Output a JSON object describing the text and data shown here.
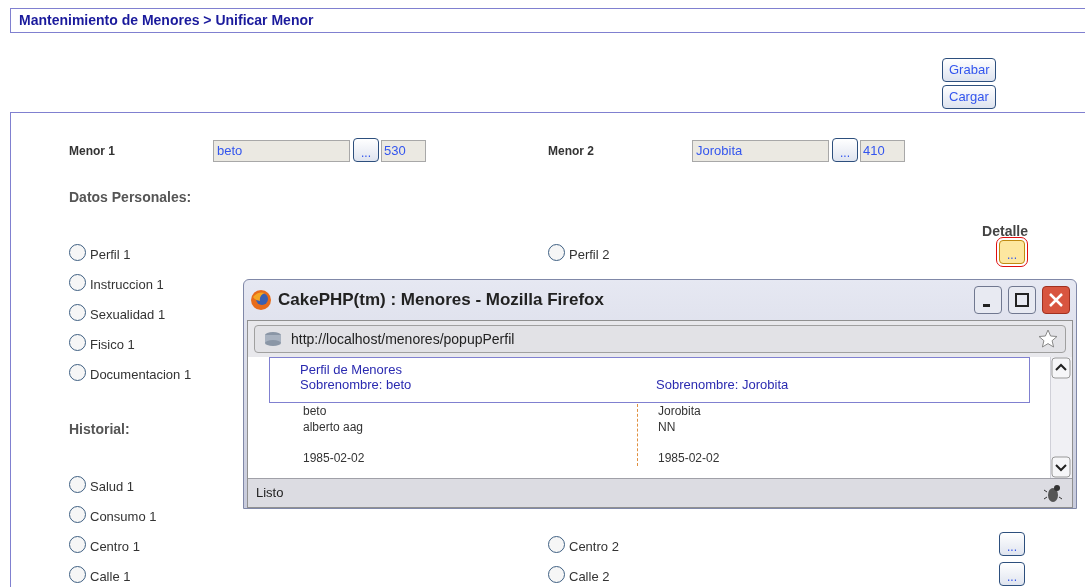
{
  "breadcrumb": "Mantenimiento de Menores > Unificar Menor",
  "actions": [
    "Grabar",
    "Cargar"
  ],
  "menores": [
    {
      "label": "Menor 1",
      "name": "beto",
      "pick": "...",
      "id": "530"
    },
    {
      "label": "Menor 2",
      "name": "Jorobita",
      "pick": "...",
      "id": "410"
    }
  ],
  "detail_heading": "Detalle",
  "sections": [
    {
      "title": "Datos Personales:",
      "rows": [
        {
          "left": {
            "label": "Perfil 1",
            "selected": false
          },
          "right": {
            "label": "Perfil 2",
            "selected": false
          },
          "detail": {
            "label": "...",
            "focused": true
          }
        },
        {
          "left": {
            "label": "Instruccion 1",
            "selected": false
          }
        },
        {
          "left": {
            "label": "Sexualidad 1",
            "selected": false
          }
        },
        {
          "left": {
            "label": "Fisico 1",
            "selected": false
          }
        },
        {
          "left": {
            "label": "Documentacion 1",
            "selected": false
          }
        }
      ]
    },
    {
      "title": "Historial:",
      "rows": [
        {
          "left": {
            "label": "Salud 1",
            "selected": false
          }
        },
        {
          "left": {
            "label": "Consumo 1",
            "selected": false
          }
        },
        {
          "left": {
            "label": "Centro 1",
            "selected": false
          },
          "right": {
            "label": "Centro 2",
            "selected": false
          },
          "detail": {
            "label": "...",
            "focused": false
          }
        },
        {
          "left": {
            "label": "Calle 1",
            "selected": false
          },
          "right": {
            "label": "Calle 2",
            "selected": false
          },
          "detail": {
            "label": "...",
            "focused": false
          }
        }
      ]
    }
  ],
  "popup": {
    "title": "CakePHP(tm) : Menores - Mozilla Firefox",
    "url": "http://localhost/menores/popupPerfil",
    "heading": "Perfil de Menores",
    "columns": [
      {
        "heading": "Sobrenombre: beto",
        "lines": [
          {
            "text": "beto",
            "gap_before": false
          },
          {
            "text": "alberto aag",
            "gap_before": false
          },
          {
            "text": "1985-02-02",
            "gap_before": true
          }
        ]
      },
      {
        "heading": "Sobrenombre: Jorobita",
        "lines": [
          {
            "text": "Jorobita",
            "gap_before": false
          },
          {
            "text": "NN",
            "gap_before": false
          },
          {
            "text": "1985-02-02",
            "gap_before": true
          }
        ]
      }
    ],
    "status": "Listo"
  }
}
